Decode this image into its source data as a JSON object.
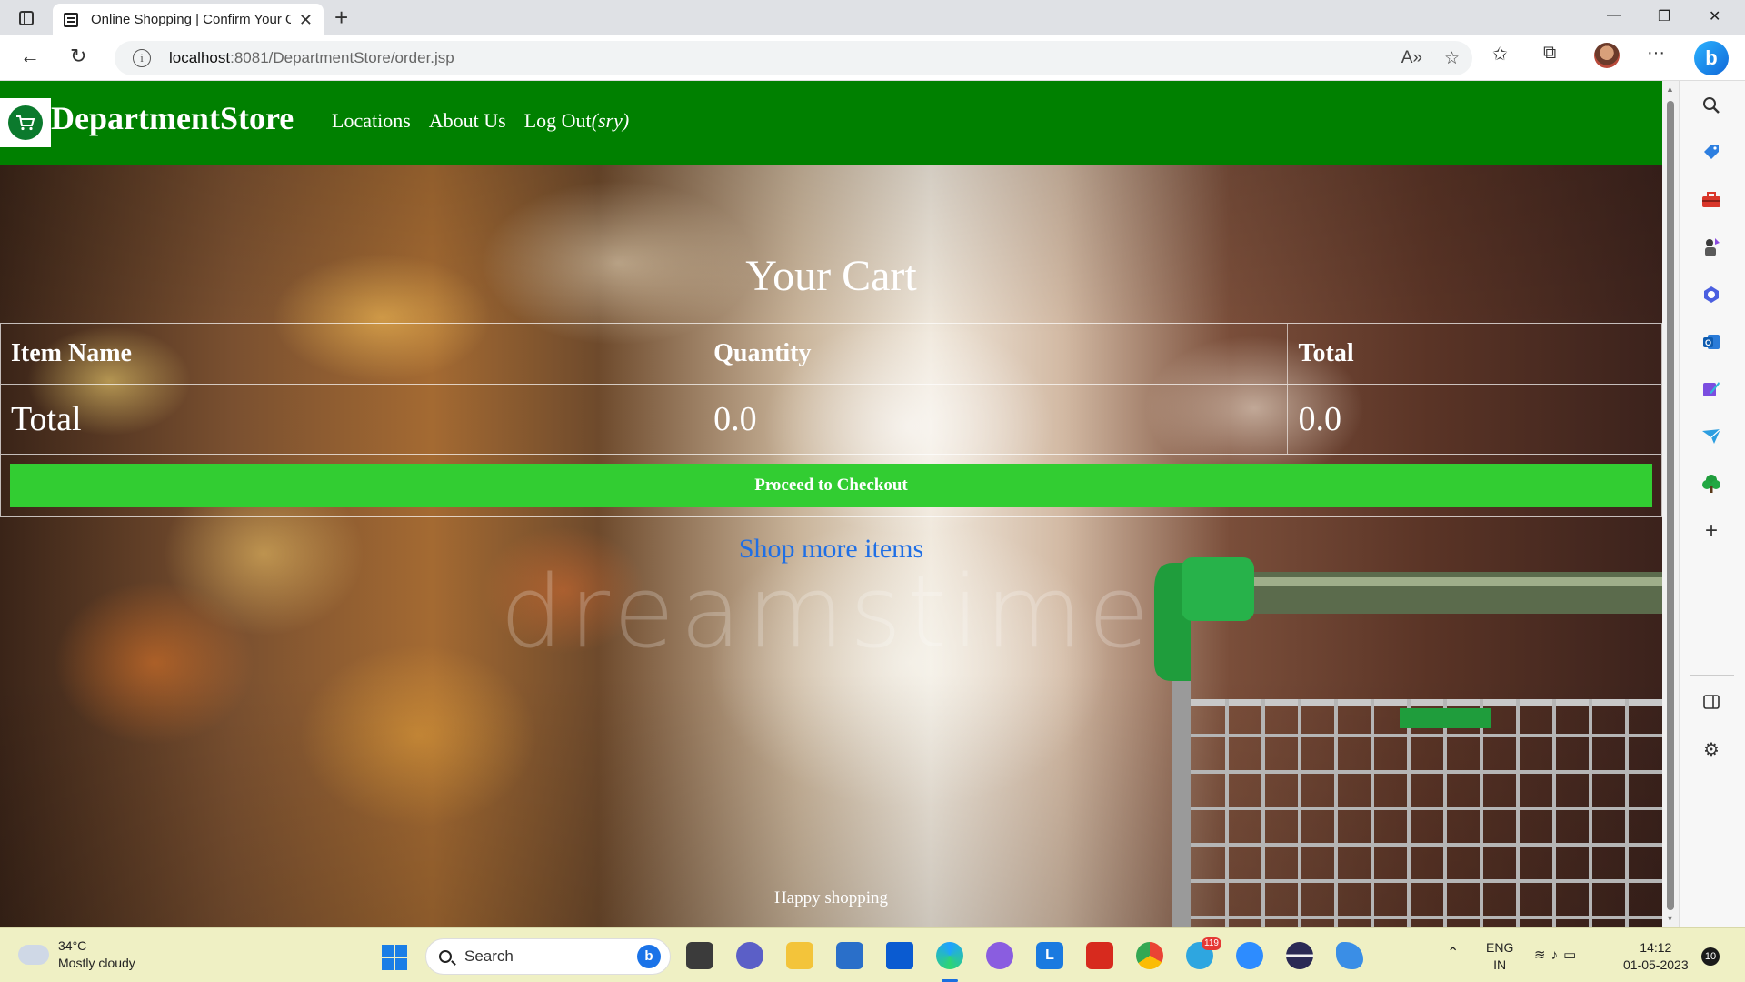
{
  "browser": {
    "tab_title": "Online Shopping | Confirm Your Order",
    "url_host": "localhost",
    "url_rest": ":8081/DepartmentStore/order.jsp",
    "new_tab_symbol": "+",
    "tab_close_symbol": "✕"
  },
  "site": {
    "brand": "DepartmentStore",
    "nav": {
      "locations": "Locations",
      "about": "About Us",
      "logout": "Log Out",
      "logout_suffix": "(sry)"
    }
  },
  "cart": {
    "title": "Your Cart",
    "columns": [
      "Item Name",
      "Quantity",
      "Total"
    ],
    "total_row": {
      "label": "Total",
      "quantity": "0.0",
      "total": "0.0"
    },
    "checkout_label": "Proceed to Checkout",
    "shop_more": "Shop more items",
    "footer": "Happy shopping",
    "watermark": "dreamstime"
  },
  "taskbar": {
    "temperature": "34°C",
    "weather": "Mostly cloudy",
    "search_placeholder": "Search",
    "telegram_badge": "119",
    "lang_line1": "ENG",
    "lang_line2": "IN",
    "time": "14:12",
    "date": "01-05-2023",
    "notification_count": "10"
  },
  "colors": {
    "navbar": "#008000",
    "checkout_button": "#32cd32",
    "link": "#1f6fe5"
  },
  "icons": [
    "tab-actions-icon",
    "page-favicon",
    "back-icon",
    "refresh-icon",
    "info-icon",
    "read-aloud-icon",
    "add-favorite-icon",
    "favorites-icon",
    "collections-icon",
    "profile-avatar",
    "more-icon",
    "bing-icon",
    "cart-logo-icon",
    "search-icon",
    "tag-icon",
    "toolbox-icon",
    "games-icon",
    "copilot-icon",
    "outlook-icon",
    "designer-icon",
    "send-icon",
    "tree-icon",
    "add-icon",
    "sidebar-toggle-icon",
    "settings-icon",
    "windows-start-icon",
    "edge-icon"
  ]
}
